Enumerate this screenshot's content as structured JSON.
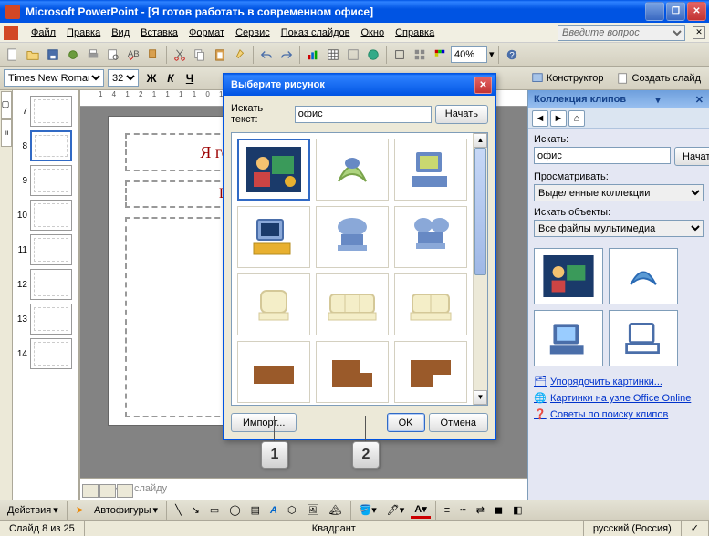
{
  "app": {
    "title": "Microsoft PowerPoint - [Я готов работать в современном офисе]"
  },
  "menu": {
    "file": "Файл",
    "edit": "Правка",
    "view": "Вид",
    "insert": "Вставка",
    "format": "Формат",
    "tools": "Сервис",
    "slideshow": "Показ слайдов",
    "window": "Окно",
    "help": "Справка",
    "help_placeholder": "Введите вопрос"
  },
  "toolbar": {
    "zoom": "40%",
    "designer": "Конструктор",
    "new_slide": "Создать слайд"
  },
  "format_bar": {
    "font": "Times New Roman",
    "size": "32",
    "bold": "Ж",
    "italic": "К",
    "underline": "Ч"
  },
  "thumbs": {
    "numbers": [
      "7",
      "8",
      "9",
      "10",
      "11",
      "12",
      "13",
      "14"
    ],
    "selected": 1
  },
  "slide": {
    "title": "Я готов",
    "subtitle": "Щ"
  },
  "ruler": "1 4 1 2 1 1 1 1 0 1 1 1 1 1 2 1 1 3 1 1 4 1 1 5",
  "notes_placeholder": "Заметки к слайду",
  "dialog": {
    "title": "Выберите рисунок",
    "search_label": "Искать текст:",
    "search_value": "офис",
    "start": "Начать",
    "import": "Импорт...",
    "ok": "OK",
    "cancel": "Отмена"
  },
  "taskpane": {
    "title": "Коллекция клипов",
    "search_label": "Искать:",
    "search_value": "офис",
    "start": "Начать",
    "browse_label": "Просматривать:",
    "browse_value": "Выделенные коллекции",
    "objects_label": "Искать объекты:",
    "objects_value": "Все файлы мультимедиа",
    "link_organize": "Упорядочить картинки...",
    "link_online": "Картинки на узле Office Online",
    "link_tips": "Советы по поиску клипов"
  },
  "callouts": {
    "c1": "1",
    "c2": "2"
  },
  "drawbar": {
    "actions": "Действия",
    "autoshapes": "Автофигуры"
  },
  "status": {
    "slide": "Слайд 8 из 25",
    "template": "Квадрант",
    "lang": "русский (Россия)"
  }
}
